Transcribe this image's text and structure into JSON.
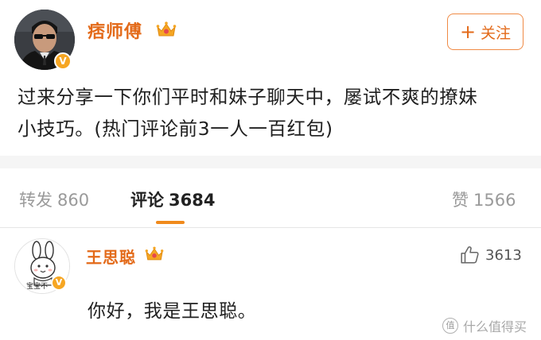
{
  "post": {
    "author": "痞师傅",
    "verified_badge": "V",
    "follow_label": "关注",
    "follow_icon": "+",
    "text_line1": "过来分享一下你们平时和妹子聊天中，屡试不爽的撩妹",
    "text_line2": "小技巧。(热门评论前3一人一百红包)"
  },
  "tabs": [
    {
      "label": "转发",
      "count": "860"
    },
    {
      "label": "评论",
      "count": "3684"
    },
    {
      "label": "赞",
      "count": "1566"
    }
  ],
  "active_tab": "评论",
  "comment": {
    "author": "王思聪",
    "verified_badge": "V",
    "avatar_caption": "宝宝不",
    "text": "你好，我是王思聪。",
    "likes": "3613"
  },
  "watermark": {
    "logo": "值",
    "text": "什么值得买"
  },
  "colors": {
    "accent": "#e36a19",
    "tab_underline": "#f08a1c",
    "badge": "#f6a623",
    "crown": "#f5a623"
  },
  "icons": {
    "crown": "crown-icon",
    "verified": "verified-badge-icon",
    "like": "thumbs-up-icon",
    "plus": "plus-icon"
  }
}
